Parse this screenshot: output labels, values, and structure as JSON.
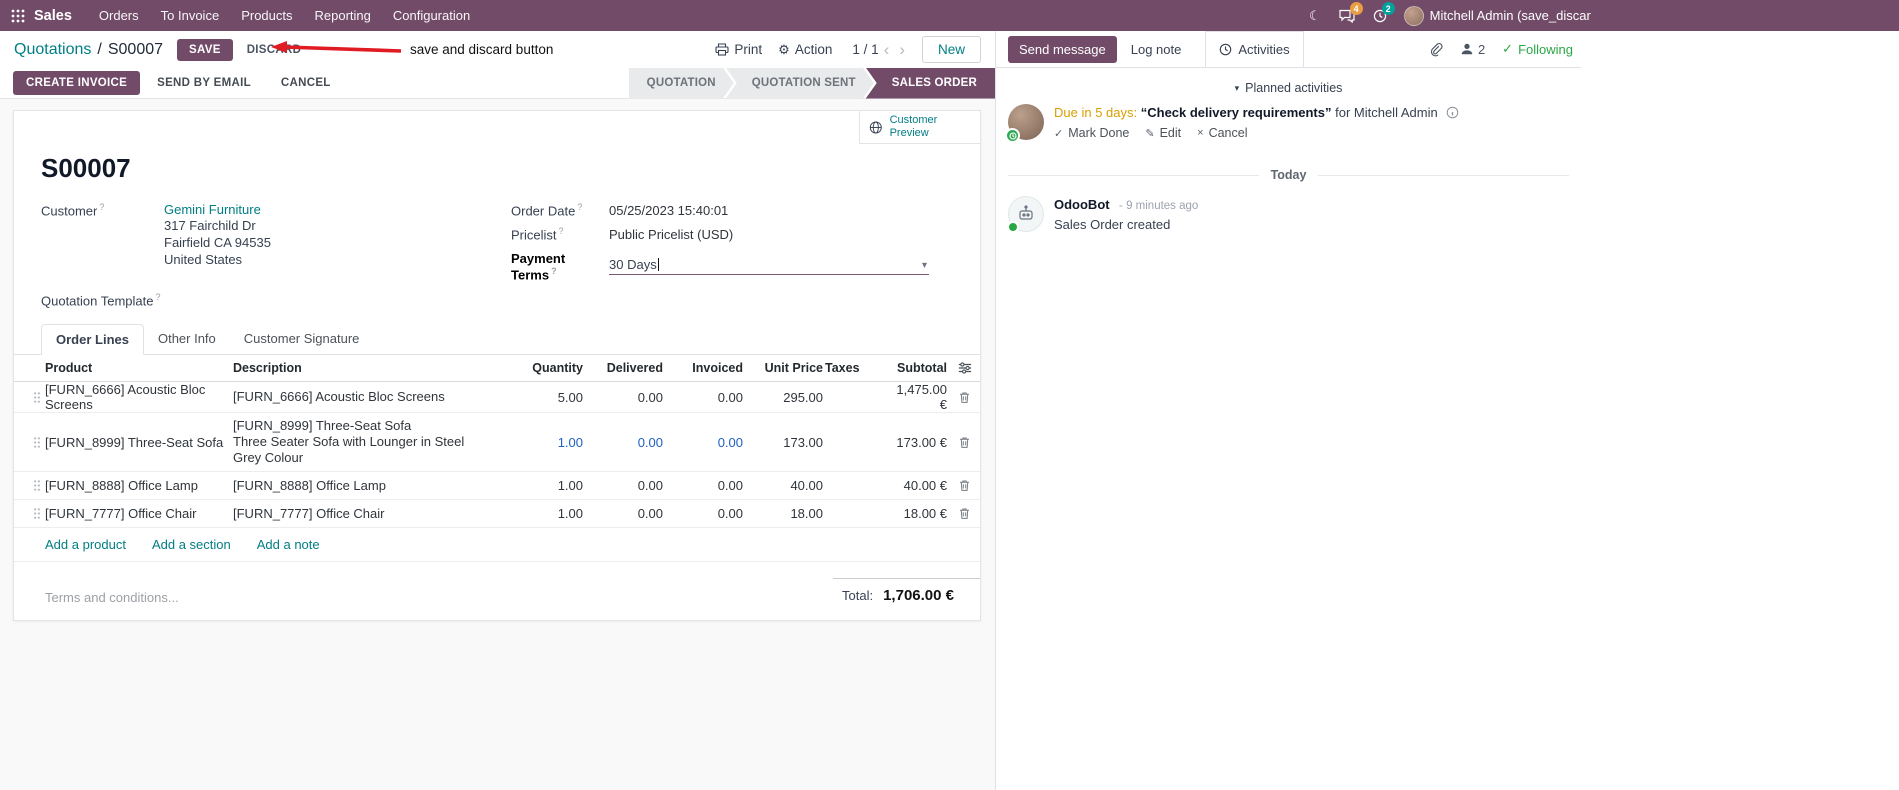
{
  "colors": {
    "accent": "#714B67",
    "link_teal": "#017e84",
    "modified_value_blue": "#2160c4",
    "following_green": "#28a745",
    "annotation_arrow_red": "#e11b22",
    "status_active_bg": "#714B67",
    "messages_badge_bg": "#e99d42",
    "activities_badge_bg": "#00a09d",
    "due_orange": "#d99e00"
  },
  "icons": {
    "moon": "☾",
    "gear": "⚙",
    "chevron_left": "‹",
    "chevron_right": "›",
    "dropdown_caret": "▾",
    "section_caret": "▾",
    "check": "✓",
    "pencil": "✎",
    "close": "×"
  },
  "topbar": {
    "app_name": "Sales",
    "menus": [
      "Orders",
      "To Invoice",
      "Products",
      "Reporting",
      "Configuration"
    ],
    "messages_badge": "4",
    "activities_badge": "2",
    "user_name": "Mitchell Admin (save_discar"
  },
  "control_panel": {
    "breadcrumb_parent": "Quotations",
    "breadcrumb_separator": "/",
    "breadcrumb_current": "S00007",
    "save_label": "SAVE",
    "discard_label": "DISCARD",
    "annotation_text": "save and discard button",
    "print_label": "Print",
    "action_label": "Action",
    "pager": "1 / 1",
    "new_label": "New"
  },
  "statusbar": {
    "buttons": [
      "CREATE INVOICE",
      "SEND BY EMAIL",
      "CANCEL"
    ],
    "states": [
      {
        "label": "QUOTATION"
      },
      {
        "label": "QUOTATION SENT"
      },
      {
        "label": "SALES ORDER"
      }
    ]
  },
  "form": {
    "help_marker": "?",
    "customer_preview_label": "Customer Preview",
    "title": "S00007",
    "fields": {
      "customer_label": "Customer",
      "customer_name": "Gemini Furniture",
      "customer_address_1": "317 Fairchild Dr",
      "customer_address_2": "Fairfield CA 94535",
      "customer_address_3": "United States",
      "quotation_template_label": "Quotation Template",
      "order_date_label": "Order Date",
      "order_date_value": "05/25/2023 15:40:01",
      "pricelist_label": "Pricelist",
      "pricelist_value": "Public Pricelist (USD)",
      "payment_terms_label": "Payment Terms",
      "payment_terms_value": "30 Days"
    },
    "tabs": [
      "Order Lines",
      "Other Info",
      "Customer Signature"
    ],
    "order_lines": {
      "headers": [
        "Product",
        "Description",
        "Quantity",
        "Delivered",
        "Invoiced",
        "Unit Price",
        "Taxes",
        "Subtotal"
      ],
      "rows": [
        {
          "product": "[FURN_6666] Acoustic Bloc Screens",
          "description": "[FURN_6666] Acoustic Bloc Screens",
          "description2": "",
          "quantity": "5.00",
          "delivered": "0.00",
          "invoiced": "0.00",
          "unit_price": "295.00",
          "taxes": "",
          "subtotal": "1,475.00 €"
        },
        {
          "product": "[FURN_8999] Three-Seat Sofa",
          "description": "[FURN_8999] Three-Seat Sofa",
          "description2": "Three Seater Sofa with Lounger in Steel Grey Colour",
          "quantity": "1.00",
          "delivered": "0.00",
          "invoiced": "0.00",
          "unit_price": "173.00",
          "taxes": "",
          "subtotal": "173.00 €"
        },
        {
          "product": "[FURN_8888] Office Lamp",
          "description": "[FURN_8888] Office Lamp",
          "description2": "",
          "quantity": "1.00",
          "delivered": "0.00",
          "invoiced": "0.00",
          "unit_price": "40.00",
          "taxes": "",
          "subtotal": "40.00 €"
        },
        {
          "product": "[FURN_7777] Office Chair",
          "description": "[FURN_7777] Office Chair",
          "description2": "",
          "quantity": "1.00",
          "delivered": "0.00",
          "invoiced": "0.00",
          "unit_price": "18.00",
          "taxes": "",
          "subtotal": "18.00 €"
        }
      ],
      "add_product": "Add a product",
      "add_section": "Add a section",
      "add_note": "Add a note"
    },
    "terms_placeholder": "Terms and conditions...",
    "total_label": "Total:",
    "total_value": "1,706.00 €"
  },
  "chatter": {
    "send_message": "Send message",
    "log_note": "Log note",
    "activities": "Activities",
    "followers_count": "2",
    "following": "Following",
    "planned_header": "Planned activities",
    "activity": {
      "due": "Due in 5 days:",
      "summary": "“Check delivery requirements”",
      "for_user": "for Mitchell Admin",
      "mark_done": "Mark Done",
      "edit": "Edit",
      "cancel": "Cancel"
    },
    "today": "Today",
    "message": {
      "author": "OdooBot",
      "time": "- 9 minutes ago",
      "body": "Sales Order created"
    }
  }
}
